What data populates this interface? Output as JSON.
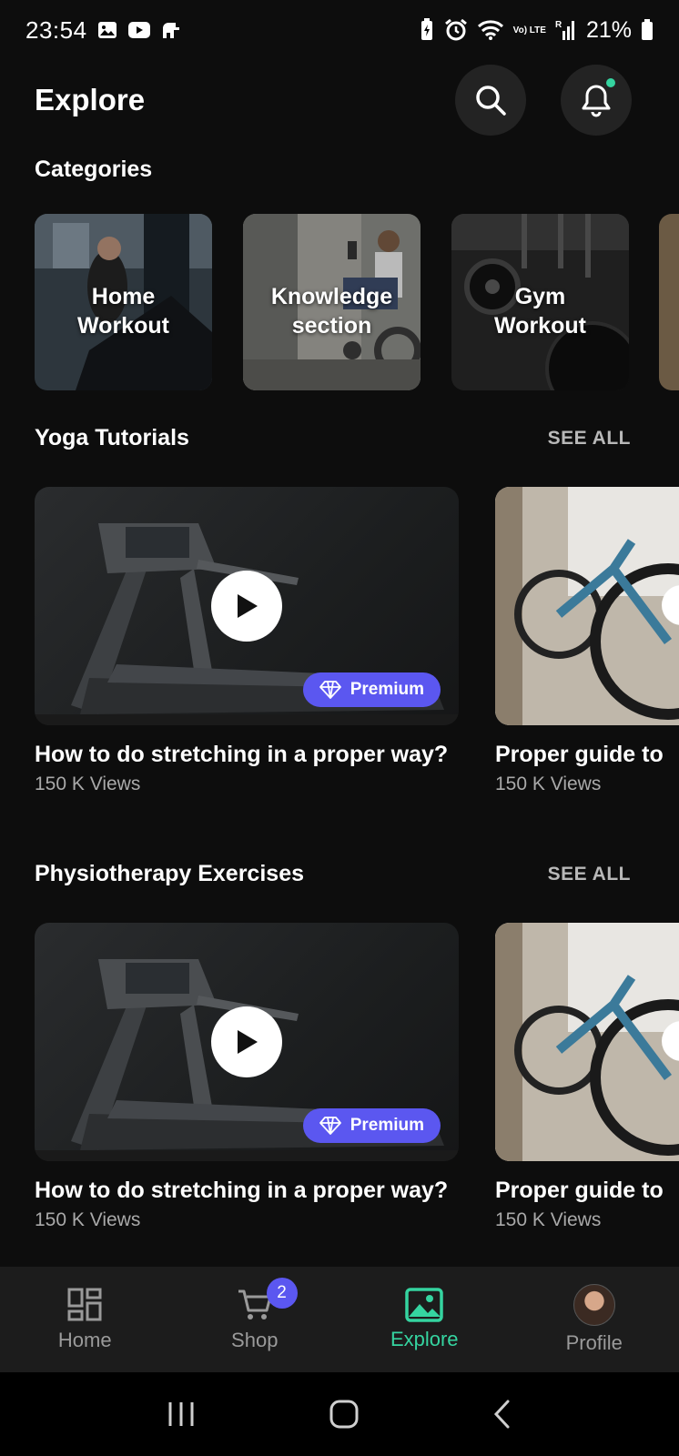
{
  "status_bar": {
    "time": "23:54",
    "battery_percent": "21%",
    "network_label": "Vo) LTE",
    "sim_label": "R"
  },
  "header": {
    "title": "Explore",
    "search_icon": "search-icon",
    "notification_icon": "bell-icon"
  },
  "categories": {
    "title": "Categories",
    "items": [
      {
        "label": "Home\nWorkout"
      },
      {
        "label": "Knowledge\nsection"
      },
      {
        "label": "Gym\nWorkout"
      }
    ]
  },
  "yoga": {
    "title": "Yoga Tutorials",
    "see_all": "SEE ALL",
    "videos": [
      {
        "title": "How to do stretching in a proper way?",
        "views": "150 K Views",
        "badge": "Premium"
      },
      {
        "title": "Proper guide to",
        "views": "150 K Views"
      }
    ]
  },
  "physio": {
    "title": "Physiotherapy Exercises",
    "see_all": "SEE ALL",
    "videos": [
      {
        "title": "How to do stretching in a proper way?",
        "views": "150 K Views",
        "badge": "Premium"
      },
      {
        "title": "Proper guide to",
        "views": "150 K Views"
      }
    ]
  },
  "bottom_nav": {
    "items": [
      {
        "label": "Home",
        "icon": "grid-icon",
        "active": false
      },
      {
        "label": "Shop",
        "icon": "cart-icon",
        "active": false,
        "badge": "2"
      },
      {
        "label": "Explore",
        "icon": "image-icon",
        "active": true
      },
      {
        "label": "Profile",
        "icon": "avatar",
        "active": false
      }
    ]
  },
  "colors": {
    "accent": "#35d4a0",
    "premium": "#5b57f0",
    "background": "#0d0d0d"
  }
}
